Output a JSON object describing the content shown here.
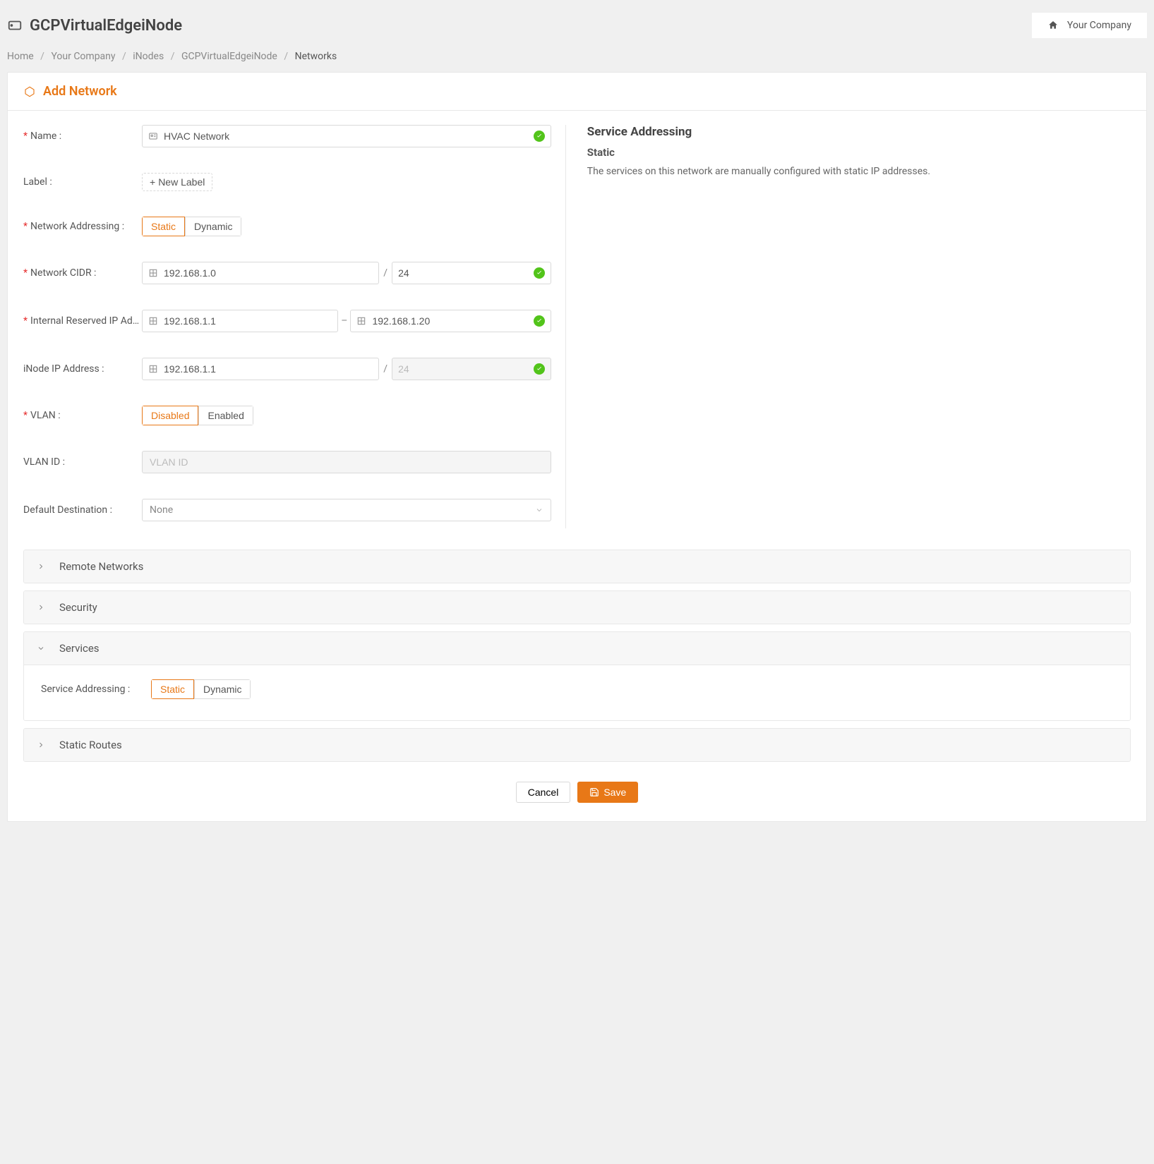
{
  "header": {
    "title": "GCPVirtualEdgeiNode",
    "org": "Your Company"
  },
  "breadcrumb": {
    "items": [
      "Home",
      "Your Company",
      "iNodes",
      "GCPVirtualEdgeiNode",
      "Networks"
    ]
  },
  "card": {
    "title": "Add Network"
  },
  "form": {
    "name": {
      "label": "Name :",
      "value": "HVAC Network"
    },
    "label_field": {
      "label": "Label :",
      "new_label": "New Label"
    },
    "network_addressing": {
      "label": "Network Addressing :",
      "options": [
        "Static",
        "Dynamic"
      ],
      "selected": "Static"
    },
    "cidr": {
      "label": "Network CIDR :",
      "ip": "192.168.1.0",
      "mask": "24"
    },
    "reserved": {
      "label": "Internal Reserved IP Addr...",
      "start": "192.168.1.1",
      "end": "192.168.1.20"
    },
    "inode_ip": {
      "label": "iNode IP Address :",
      "ip": "192.168.1.1",
      "mask": "24"
    },
    "vlan": {
      "label": "VLAN :",
      "options": [
        "Disabled",
        "Enabled"
      ],
      "selected": "Disabled"
    },
    "vlan_id": {
      "label": "VLAN ID :",
      "placeholder": "VLAN ID"
    },
    "default_dest": {
      "label": "Default Destination :",
      "value": "None"
    }
  },
  "help": {
    "title": "Service Addressing",
    "subtitle": "Static",
    "text": "The services on this network are manually configured with static IP addresses."
  },
  "panels": {
    "remote": "Remote Networks",
    "security": "Security",
    "services": "Services",
    "static_routes": "Static Routes"
  },
  "services": {
    "label": "Service Addressing :",
    "options": [
      "Static",
      "Dynamic"
    ],
    "selected": "Static"
  },
  "actions": {
    "cancel": "Cancel",
    "save": "Save"
  }
}
